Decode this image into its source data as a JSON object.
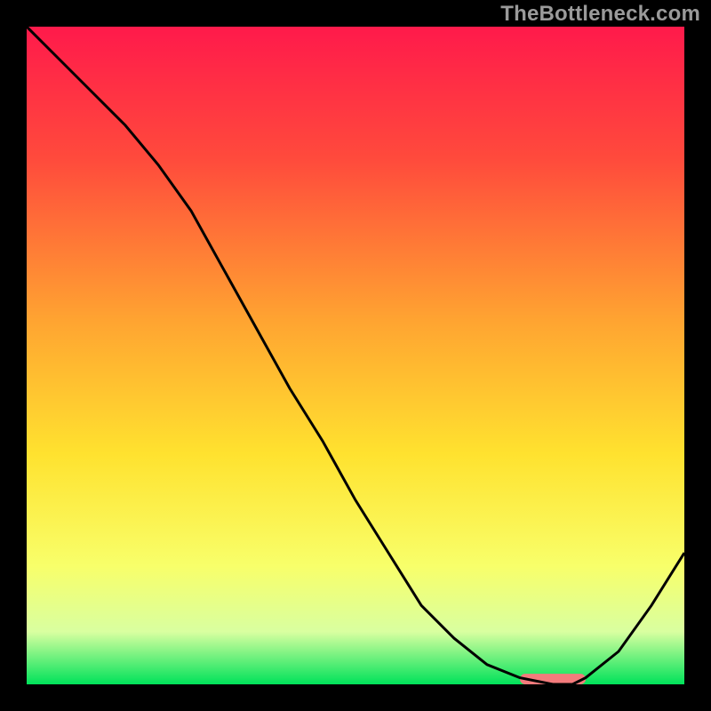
{
  "watermark": "TheBottleneck.com",
  "chart_data": {
    "type": "line",
    "title": "",
    "xlabel": "",
    "ylabel": "",
    "xlim": [
      0,
      100
    ],
    "ylim": [
      0,
      100
    ],
    "grid": false,
    "legend": false,
    "series": [
      {
        "name": "bottleneck-curve",
        "color": "#000000",
        "x": [
          0,
          5,
          10,
          15,
          20,
          25,
          30,
          35,
          40,
          45,
          50,
          55,
          60,
          65,
          70,
          75,
          80,
          83,
          85,
          90,
          95,
          100
        ],
        "y": [
          100,
          95,
          90,
          85,
          79,
          72,
          63,
          54,
          45,
          37,
          28,
          20,
          12,
          7,
          3,
          1,
          0,
          0,
          1,
          5,
          12,
          20
        ]
      }
    ],
    "marker_bar": {
      "name": "highlight-range",
      "color": "#f37b7c",
      "x_start": 75,
      "x_end": 85,
      "y": 0,
      "thickness_pct": 1.6
    },
    "background_gradient": {
      "stops": [
        {
          "offset": 0.0,
          "color": "#ff1a4b"
        },
        {
          "offset": 0.2,
          "color": "#ff4a3c"
        },
        {
          "offset": 0.45,
          "color": "#ffa531"
        },
        {
          "offset": 0.65,
          "color": "#ffe22f"
        },
        {
          "offset": 0.82,
          "color": "#f8ff6a"
        },
        {
          "offset": 0.92,
          "color": "#d9ffa0"
        },
        {
          "offset": 1.0,
          "color": "#00e25a"
        }
      ]
    }
  }
}
